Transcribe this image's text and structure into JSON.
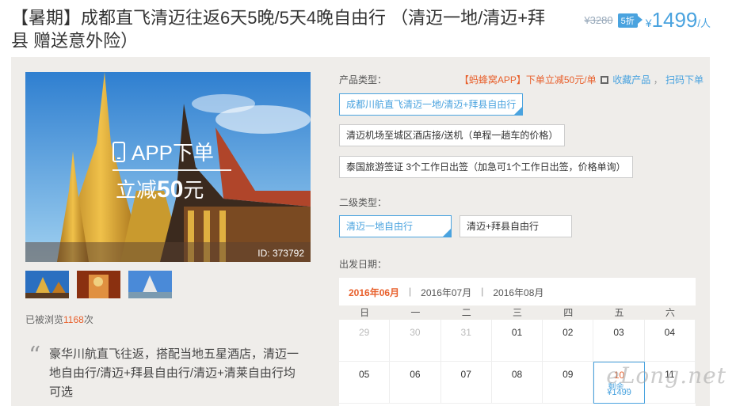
{
  "title": "【暑期】成都直飞清迈往返6天5晚/5天4晚自由行 （清迈一地/清迈+拜县 赠送意外险）",
  "price": {
    "old": "¥3280",
    "discount": "5折",
    "currency": "¥",
    "value": "1499",
    "unit": "/人"
  },
  "hero": {
    "app_line1": "APP下单",
    "app_line2_prefix": "立减",
    "app_line2_amount": "50",
    "app_line2_suffix": "元",
    "image_id": "ID: 373792"
  },
  "views": {
    "prefix": "已被浏览",
    "count": "1168",
    "suffix": "次"
  },
  "quote": {
    "mark": "“",
    "text": "豪华川航直飞往返，搭配当地五星酒店，清迈一地自由行/清迈+拜县自由行/清迈+清莱自由行均可选"
  },
  "product": {
    "type_label": "产品类型：",
    "promo_text": "【蚂蜂窝APP】下单立减50元/单",
    "collect": "收藏产品",
    "scan": "扫码下单",
    "types": [
      "成都川航直飞清迈一地/清迈+拜县自由行",
      "清迈机场至城区酒店接/送机（单程一趟车的价格）",
      "泰国旅游签证 3个工作日出签（加急可1个工作日出签，价格单询）"
    ],
    "sub_label": "二级类型：",
    "subtypes": [
      "清迈一地自由行",
      "清迈+拜县自由行"
    ],
    "date_label": "出发日期："
  },
  "calendar": {
    "months": [
      "2016年06月",
      "2016年07月",
      "2016年08月"
    ],
    "sep": "|",
    "weekdays": [
      "日",
      "一",
      "二",
      "三",
      "四",
      "五",
      "六"
    ],
    "row1": [
      "29",
      "30",
      "31",
      "01",
      "02",
      "03",
      "04"
    ],
    "row2": [
      "05",
      "06",
      "07",
      "08",
      "09",
      "10",
      "11"
    ],
    "remain": "剩余...",
    "cell_price": "¥1499"
  },
  "watermark": "eLong.net",
  "colors": {
    "accent_blue": "#4aa3df",
    "accent_orange": "#e8602c",
    "panel_bg": "#efedea"
  }
}
